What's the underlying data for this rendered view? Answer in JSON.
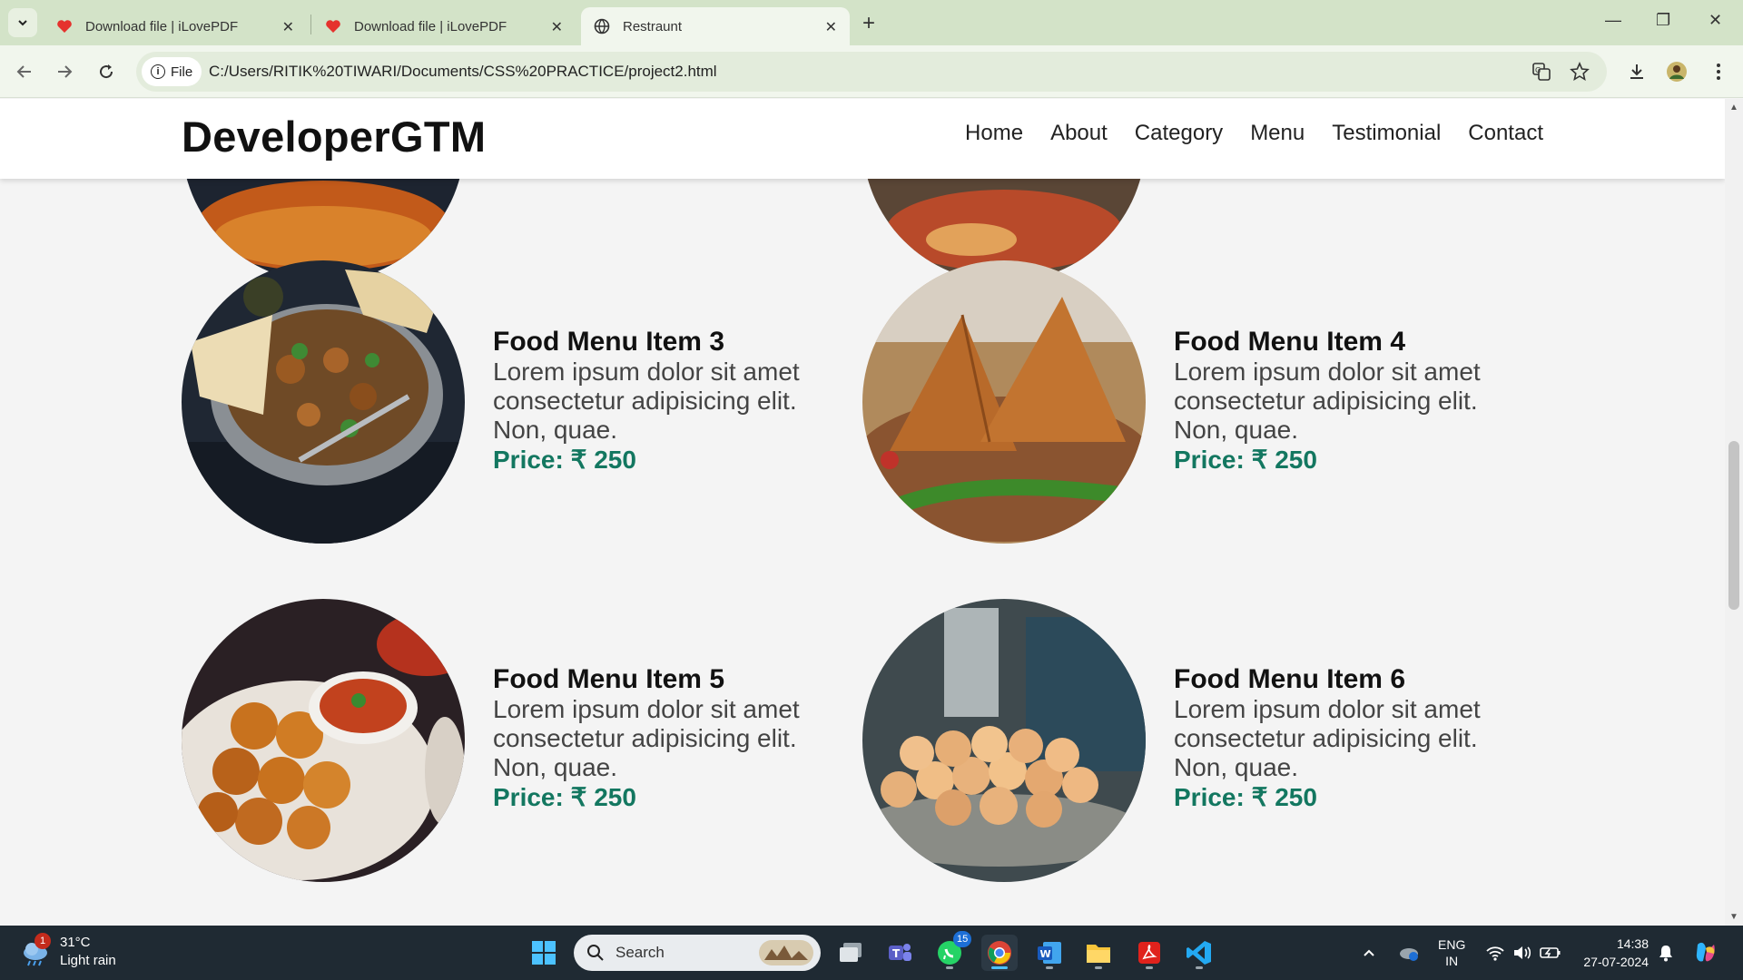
{
  "browser": {
    "tabs": [
      {
        "title": "Download file | iLovePDF",
        "active": false
      },
      {
        "title": "Download file | iLovePDF",
        "active": false
      },
      {
        "title": "Restraunt",
        "active": true
      }
    ],
    "omnibox": {
      "scheme_chip": "File",
      "url": "C:/Users/RITIK%20TIWARI/Documents/CSS%20PRACTICE/project2.html"
    }
  },
  "site": {
    "brand": "DeveloperGTM",
    "nav": [
      "Home",
      "About",
      "Category",
      "Menu",
      "Testimonial",
      "Contact"
    ],
    "items": [
      {
        "title": "Food Menu Item 3",
        "desc": "Lorem ipsum dolor sit amet consectetur adipisicing elit. Non, quae.",
        "price": "Price: ₹ 250"
      },
      {
        "title": "Food Menu Item 4",
        "desc": "Lorem ipsum dolor sit amet consectetur adipisicing elit. Non, quae.",
        "price": "Price: ₹ 250"
      },
      {
        "title": "Food Menu Item 5",
        "desc": "Lorem ipsum dolor sit amet consectetur adipisicing elit. Non, quae.",
        "price": "Price: ₹ 250"
      },
      {
        "title": "Food Menu Item 6",
        "desc": "Lorem ipsum dolor sit amet consectetur adipisicing elit. Non, quae.",
        "price": "Price: ₹ 250"
      }
    ]
  },
  "taskbar": {
    "weather": {
      "temp": "31°C",
      "condition": "Light rain",
      "badge": "1"
    },
    "search_placeholder": "Search",
    "whatsapp_badge": "15",
    "tray": {
      "lang": "ENG",
      "region": "IN",
      "time": "14:38",
      "date": "27-07-2024"
    }
  },
  "colors": {
    "accent_price": "#137760",
    "tabbar": "#d3e3c8",
    "taskbar": "#1f2a33"
  }
}
